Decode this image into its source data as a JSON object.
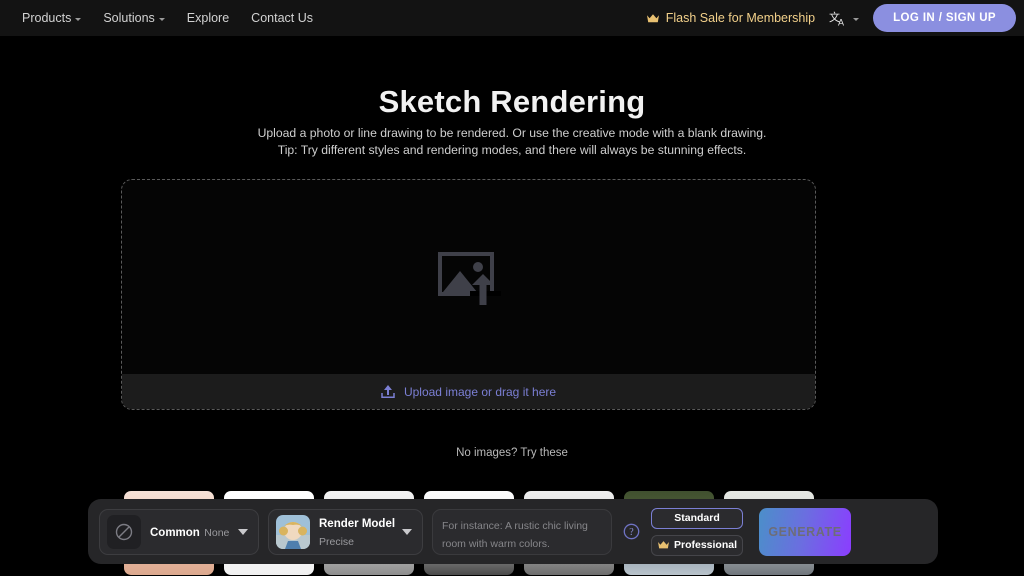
{
  "header": {
    "nav": [
      {
        "label": "Products",
        "caret": true,
        "icon": "chevron-down-icon"
      },
      {
        "label": "Solutions",
        "caret": true,
        "icon": "chevron-down-icon"
      },
      {
        "label": "Explore",
        "caret": false,
        "icon": ""
      },
      {
        "label": "Contact Us",
        "caret": false,
        "icon": ""
      }
    ],
    "flash_sale": {
      "label": "Flash Sale for Membership",
      "icon": "crown-icon",
      "color": "#f2d08a"
    },
    "language": {
      "icon": "translate-icon",
      "caret_icon": "chevron-down-icon"
    },
    "login_label": "LOG IN / SIGN UP",
    "login_color": "#8b8fe0"
  },
  "main": {
    "title": "Sketch Rendering",
    "subtitle_line1": "Upload a photo or line drawing to be rendered. Or use the creative mode with a blank drawing.",
    "subtitle_line2": "Tip: Try different styles and rendering modes, and there will always be stunning effects.",
    "dropzone": {
      "icon": "image-upload-icon",
      "upload_icon": "upload-arrow-icon",
      "upload_label": "Upload image or drag it here",
      "upload_color": "#7b7fd4"
    },
    "try_these_label": "No images?  Try these",
    "thumbnails": [
      {
        "name": "thumbnail-1"
      },
      {
        "name": "thumbnail-2"
      },
      {
        "name": "thumbnail-3"
      },
      {
        "name": "thumbnail-4"
      },
      {
        "name": "thumbnail-5"
      },
      {
        "name": "thumbnail-6"
      },
      {
        "name": "thumbnail-7"
      }
    ]
  },
  "toolbar": {
    "style_selector": {
      "title": "Common",
      "value": "None",
      "icon": "no-style-icon"
    },
    "model_selector": {
      "title": "Render Model",
      "value": "Precise",
      "icon": "model-thumbnail"
    },
    "prompt": {
      "placeholder": "For instance: A rustic chic living room with warm colors.",
      "value": ""
    },
    "help_icon": "help-circle-icon",
    "quality": [
      {
        "label": "Standard",
        "selected": true,
        "icon": ""
      },
      {
        "label": "Professional",
        "selected": false,
        "icon": "crown-icon"
      }
    ],
    "generate_label": "GENERATE",
    "generate_gradient_from": "#4b8fc9",
    "generate_gradient_to": "#8b3dff"
  }
}
